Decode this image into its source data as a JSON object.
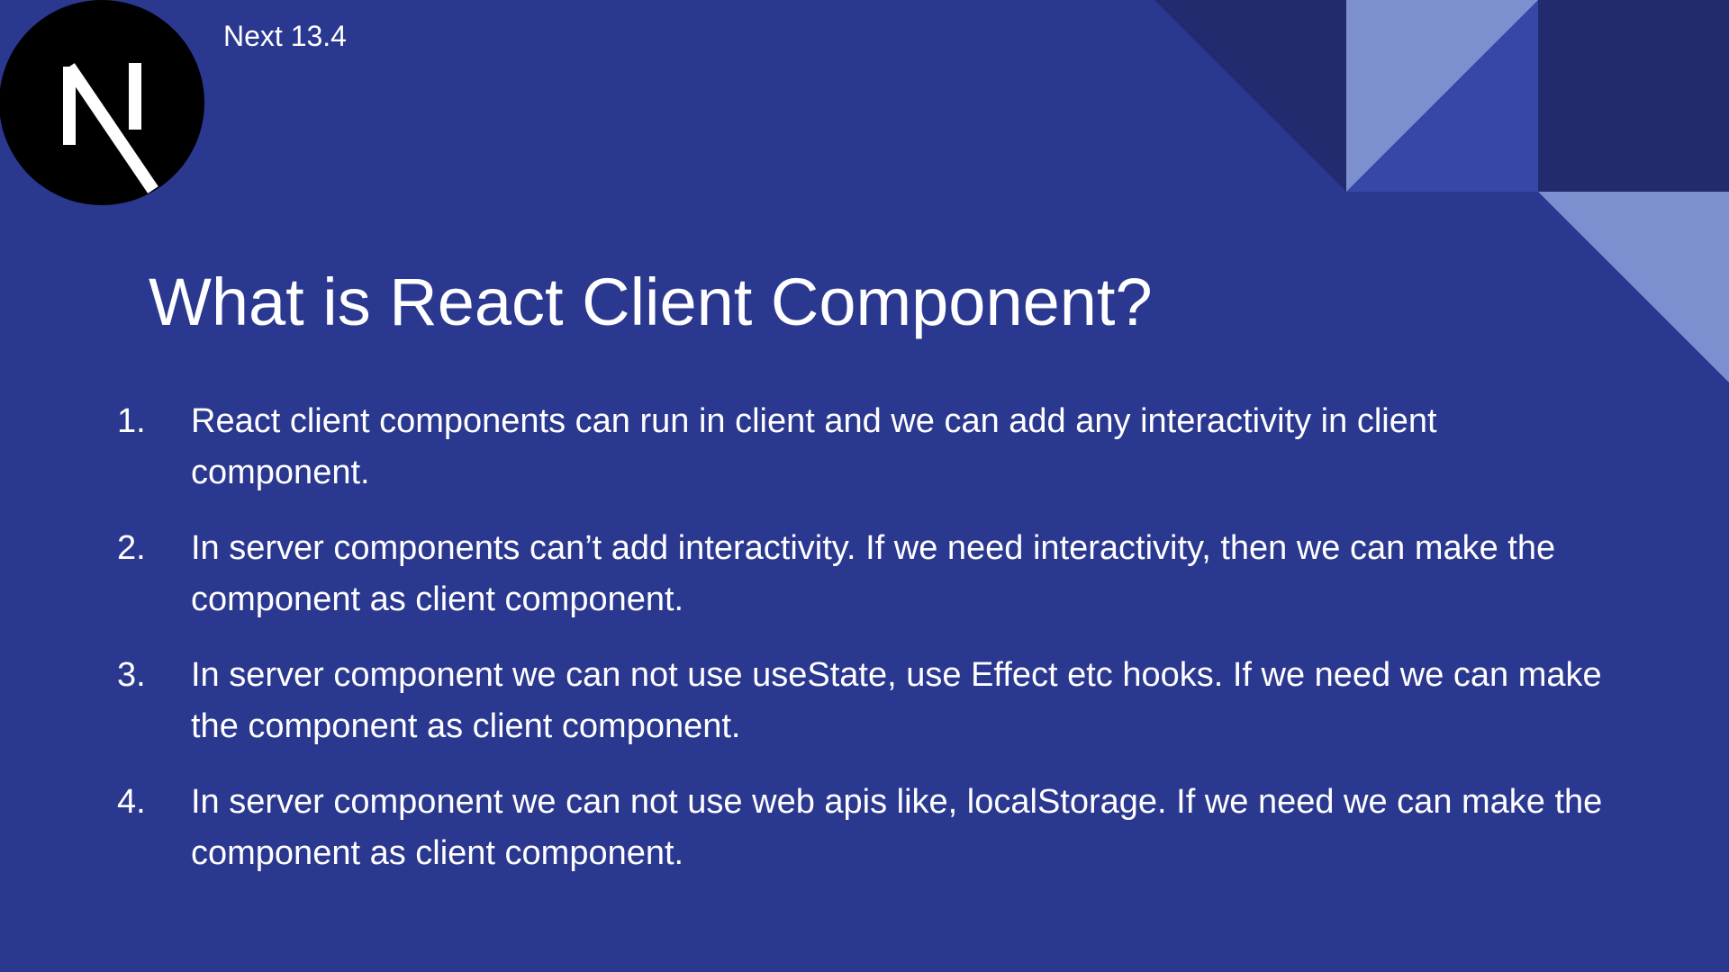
{
  "header": {
    "brand_label": "Next 13.4",
    "logo_icon": "nextjs-logo-icon"
  },
  "slide": {
    "title": "What is React Client Component?",
    "points": [
      {
        "number": "1.",
        "text": "React client components can run in client and we can add any interactivity in client component."
      },
      {
        "number": "2.",
        "text": "In server components can’t add interactivity. If we need interactivity, then we can make the component as client component."
      },
      {
        "number": "3.",
        "text": "In server component we can not use useState, use Effect etc hooks. If we need we can make the component as client component."
      },
      {
        "number": "4.",
        "text": "In server component we can not use web apis like, localStorage. If we need we can make the component as client component."
      }
    ]
  },
  "colors": {
    "background": "#2b3890",
    "dark_shape": "#222b6e",
    "light_shape": "#7c8fcf",
    "mid_shape": "#3647a8",
    "text": "#ffffff"
  }
}
